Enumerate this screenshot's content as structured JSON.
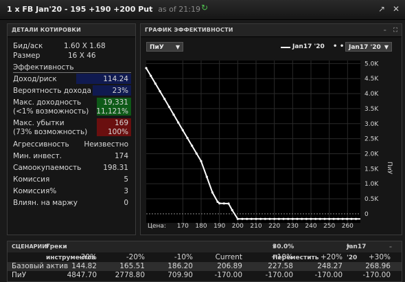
{
  "window": {
    "title": "1 x FB Jan'20  - 195  +190  +200 Put",
    "as_of": "as of 21:19"
  },
  "quote_details": {
    "header": "ДЕТАЛИ КОТИРОВКИ",
    "bid_ask_label": "Бид/аск",
    "bid_ask_value": "1.60 X 1.68",
    "size_label": "Размер",
    "size_value": "16 X 46",
    "efficiency_label": "Эффективность",
    "income_risk_label": "Доход/риск",
    "income_risk_value": "114.24",
    "income_prob_label": "Вероятность дохода",
    "income_prob_value": "23%",
    "max_profit_label": "Макс. доходность",
    "max_profit_sub": "(<1% возможность)",
    "max_profit_value": "19,331",
    "max_profit_pct": "11,121%",
    "max_loss_label": "Макс. убытки",
    "max_loss_sub": "(73% возможность)",
    "max_loss_value": "169",
    "max_loss_pct": "100%",
    "aggressiveness_label": "Агрессивность",
    "aggressiveness_value": "Неизвестно",
    "min_invest_label": "Мин. инвест.",
    "min_invest_value": "174",
    "breakeven_label": "Самоокупаемость",
    "breakeven_value": "198.31",
    "commission_label": "Комиссия",
    "commission_value": "5",
    "commission_pct_label": "Комиссия%",
    "commission_pct_value": "3",
    "margin_label": "Влиян. на маржу",
    "margin_value": "0"
  },
  "perf_chart": {
    "header": "ГРАФИК ЭФФЕКТИВНОСТИ",
    "metric_select": "ПиУ",
    "legend_solid": "Jan17 '20",
    "legend_dotted_select": "Jan17 '20",
    "x_prefix": "Цена:",
    "y_axis_title": "ПиУ"
  },
  "chart_data": {
    "type": "line",
    "x_ticks": [
      170,
      180,
      190,
      200,
      210,
      220,
      230,
      240,
      250,
      260
    ],
    "y_ticks": [
      "0",
      "0.5K",
      "1.0K",
      "1.5K",
      "2.0K",
      "2.5K",
      "3.0K",
      "3.5K",
      "4.0K",
      "4.5K",
      "5.0K"
    ],
    "xlim": [
      150,
      267
    ],
    "ylim": [
      -300,
      5100
    ],
    "series": [
      {
        "name": "Jan17 '20",
        "points": [
          [
            150,
            4848
          ],
          [
            160,
            3820
          ],
          [
            170,
            2779
          ],
          [
            180,
            1750
          ],
          [
            186.2,
            710
          ],
          [
            189,
            400
          ],
          [
            190,
            350
          ],
          [
            195,
            340
          ],
          [
            197,
            120
          ],
          [
            200,
            -170
          ],
          [
            210,
            -170
          ],
          [
            230,
            -170
          ],
          [
            250,
            -170
          ],
          [
            267,
            -170
          ]
        ]
      }
    ]
  },
  "scenarios": {
    "header": "СЦЕНАРИИ",
    "instrument_greeks": "Греки инструментов",
    "move_label": "30.0% Переместить",
    "expiry_select": "Jan17 '20",
    "columns": [
      "-30%",
      "-20%",
      "-10%",
      "Current",
      "+10%",
      "+20%",
      "+30%"
    ],
    "rows": [
      {
        "name": "Базовый актив",
        "values": [
          "144.82",
          "165.51",
          "186.20",
          "206.89",
          "227.58",
          "248.27",
          "268.96"
        ]
      },
      {
        "name": "ПиУ",
        "values": [
          "4847.70",
          "2778.80",
          "709.90",
          "-170.00",
          "-170.00",
          "-170.00",
          "-170.00"
        ]
      }
    ]
  }
}
